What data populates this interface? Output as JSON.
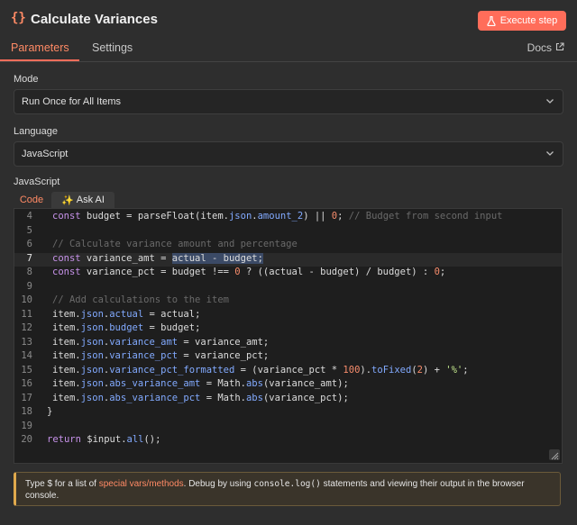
{
  "header": {
    "icon": "code-braces-icon",
    "icon_glyph": "{}",
    "title": "Calculate Variances",
    "execute_label": "Execute step"
  },
  "tabs": {
    "parameters": "Parameters",
    "settings": "Settings",
    "docs": "Docs"
  },
  "mode": {
    "label": "Mode",
    "value": "Run Once for All Items"
  },
  "language": {
    "label": "Language",
    "value": "JavaScript"
  },
  "editor": {
    "section_label": "JavaScript",
    "tab_code": "Code",
    "tab_ai": "Ask AI",
    "lines": [
      {
        "n": "4",
        "text": "    const budget = parseFloat(item.json.amount_2) || 0; // Budget from second input"
      },
      {
        "n": "5",
        "text": ""
      },
      {
        "n": "6",
        "text": "    // Calculate variance amount and percentage"
      },
      {
        "n": "7",
        "text": "    const variance_amt = actual - budget;",
        "active": true
      },
      {
        "n": "8",
        "text": "    const variance_pct = budget !== 0 ? ((actual - budget) / budget) : 0;"
      },
      {
        "n": "9",
        "text": ""
      },
      {
        "n": "10",
        "text": "    // Add calculations to the item"
      },
      {
        "n": "11",
        "text": "    item.json.actual = actual;"
      },
      {
        "n": "12",
        "text": "    item.json.budget = budget;"
      },
      {
        "n": "13",
        "text": "    item.json.variance_amt = variance_amt;"
      },
      {
        "n": "14",
        "text": "    item.json.variance_pct = variance_pct;"
      },
      {
        "n": "15",
        "text": "    item.json.variance_pct_formatted = (variance_pct * 100).toFixed(2) + '%';"
      },
      {
        "n": "16",
        "text": "    item.json.abs_variance_amt = Math.abs(variance_amt);"
      },
      {
        "n": "17",
        "text": "    item.json.abs_variance_pct = Math.abs(variance_pct);"
      },
      {
        "n": "18",
        "text": "  }"
      },
      {
        "n": "19",
        "text": ""
      },
      {
        "n": "20",
        "text": "  return $input.all();"
      }
    ]
  },
  "hint": {
    "prefix": "Type $ for a list of ",
    "link": "special vars/methods",
    "middle": ". Debug by using ",
    "code": "console.log()",
    "suffix": " statements and viewing their output in the browser console."
  },
  "colors": {
    "accent": "#ff6d5a",
    "background": "#2e2e2e",
    "editor_bg": "#1e1e1e"
  }
}
